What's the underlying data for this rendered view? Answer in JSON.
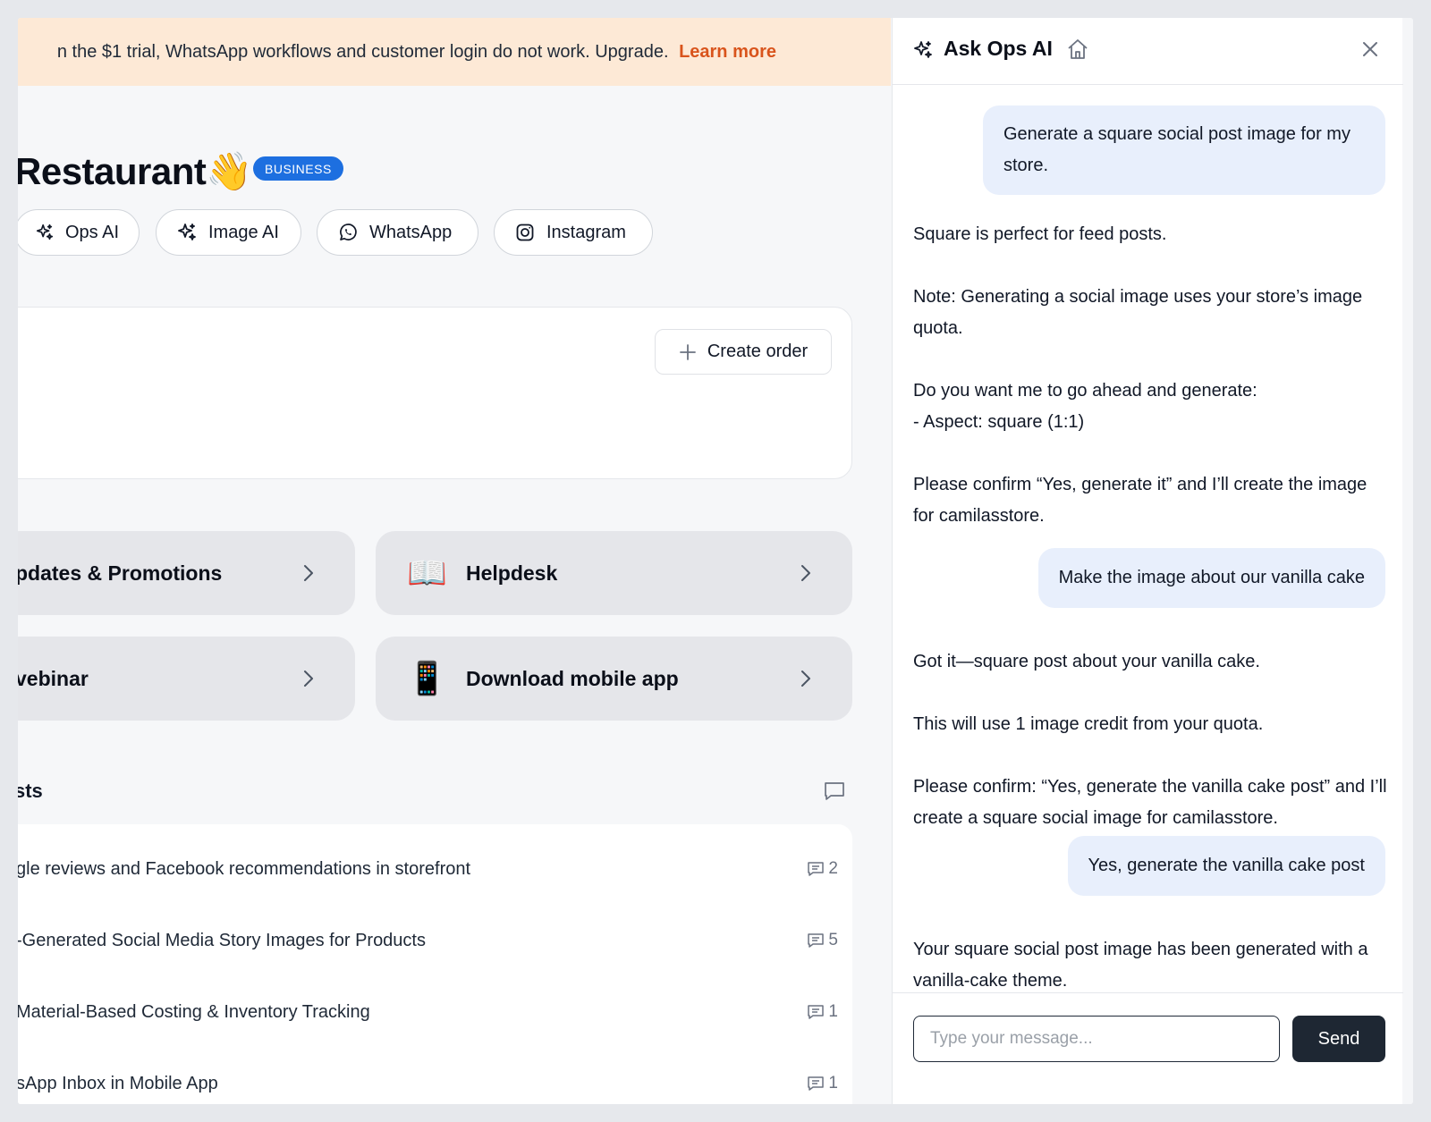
{
  "banner": {
    "text": "n the $1 trial, WhatsApp workflows and customer login do not work. Upgrade.",
    "link": "Learn more"
  },
  "store": {
    "title": "Restaurant",
    "emoji": "👋",
    "badge": "BUSINESS"
  },
  "quick_actions": [
    {
      "label": "Ops AI",
      "icon": "sparkle-icon"
    },
    {
      "label": "Image AI",
      "icon": "sparkle-icon"
    },
    {
      "label": "WhatsApp",
      "icon": "whatsapp-icon"
    },
    {
      "label": "Instagram",
      "icon": "instagram-icon"
    }
  ],
  "orders_card": {
    "create_label": "Create order"
  },
  "tiles": [
    {
      "label": "pdates & Promotions",
      "emoji": ""
    },
    {
      "label": "Helpdesk",
      "emoji": "📖"
    },
    {
      "label": "vebinar",
      "emoji": ""
    },
    {
      "label": "Download mobile app",
      "emoji": "📱"
    }
  ],
  "requests": {
    "heading": "sts",
    "rows": [
      {
        "title": "gle reviews and Facebook recommendations in storefront",
        "count": "2"
      },
      {
        "title": "-Generated Social Media Story Images for Products",
        "count": "5"
      },
      {
        "title": "Material-Based Costing & Inventory Tracking",
        "count": "1"
      },
      {
        "title": "sApp Inbox in Mobile App",
        "count": "1"
      }
    ]
  },
  "assistant": {
    "title": "Ask Ops AI",
    "messages": [
      {
        "role": "user",
        "text": "Generate a square social post image for my store."
      },
      {
        "role": "ai",
        "text": "Square is perfect for feed posts.\n\nNote: Generating a social image uses your store’s image quota.\n\nDo you want me to go ahead and generate:\n- Aspect: square (1:1)\n\nPlease confirm “Yes, generate it” and I’ll create the image for camilasstore."
      },
      {
        "role": "user",
        "text": "Make the image about our vanilla cake"
      },
      {
        "role": "ai",
        "text": "Got it—square post about your vanilla cake.\n\nThis will use 1 image credit from your quota.\n\nPlease confirm: “Yes, generate the vanilla cake post” and I’ll create a square social image for camilasstore."
      },
      {
        "role": "user",
        "text": "Yes, generate the vanilla cake post"
      },
      {
        "role": "ai",
        "text": "Your square social post image has been generated with a vanilla-cake theme."
      }
    ],
    "input_placeholder": "Type your message...",
    "send_label": "Send"
  },
  "colors": {
    "banner_bg": "#fde9d6",
    "link": "#d9541c",
    "badge": "#1d6fe0",
    "bubble": "#e8effc",
    "send": "#1e2733"
  }
}
